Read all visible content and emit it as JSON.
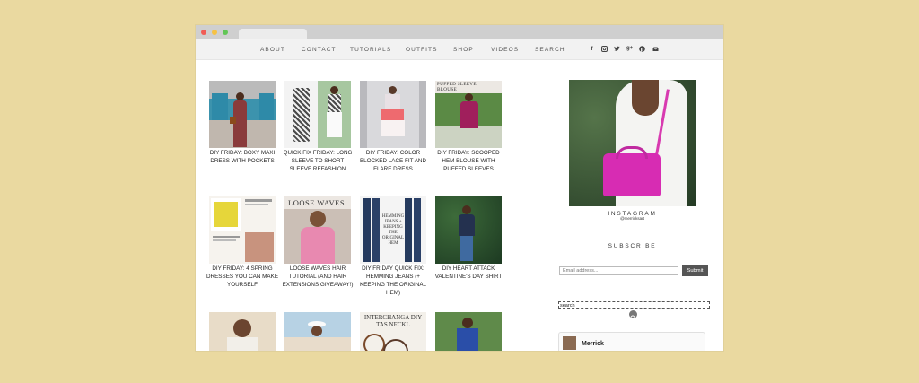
{
  "nav": {
    "items": [
      "About",
      "Contact",
      "Tutorials",
      "Outfits",
      "Shop",
      "Videos",
      "Search"
    ],
    "social_icons": [
      "facebook-icon",
      "instagram-icon",
      "twitter-icon",
      "google-plus-icon",
      "pinterest-icon",
      "email-icon"
    ]
  },
  "posts": [
    {
      "caption": "DIY Friday: Boxy Maxi Dress with Pockets"
    },
    {
      "caption": "Quick Fix Friday: Long Sleeve to Short Sleeve Refashion"
    },
    {
      "caption": "DIY Friday: Color Blocked Lace Fit and Flare Dress"
    },
    {
      "caption": "DIY Friday: Scooped Hem Blouse with Puffed Sleeves"
    },
    {
      "caption": "DIY Friday: 4 Spring Dresses You Can Make Yourself"
    },
    {
      "caption": "Loose Waves Hair Tutorial (and Hair Extensions Giveaway!)"
    },
    {
      "caption": "DIY Friday Quick Fix: Hemming Jeans (+ Keeping the Original Hem)"
    },
    {
      "caption": "DIY Heart Attack Valentine's Day Shirt"
    },
    {
      "caption": ""
    },
    {
      "caption": ""
    },
    {
      "caption": ""
    },
    {
      "caption": ""
    }
  ],
  "thumb_text": {
    "puffed": "PUFFED SLEEVE BLOUSE",
    "waves": "LOOSE WAVES",
    "hemming": "HEMMING JEANS + KEEPING THE ORIGINAL HEM",
    "interchange": "INTERCHANGA DIY TAS NECKL"
  },
  "sidebar": {
    "instagram_title": "INSTAGRAM",
    "instagram_handle": "@merricksart",
    "subscribe_title": "SUBSCRIBE",
    "email_placeholder": "Email address...",
    "submit_label": "Submit",
    "search_value": "search",
    "profile_name": "Merrick"
  },
  "colors": {
    "background": "#ead9a0",
    "chrome": "#cfcfcf",
    "navbar": "#f2f2f2"
  }
}
